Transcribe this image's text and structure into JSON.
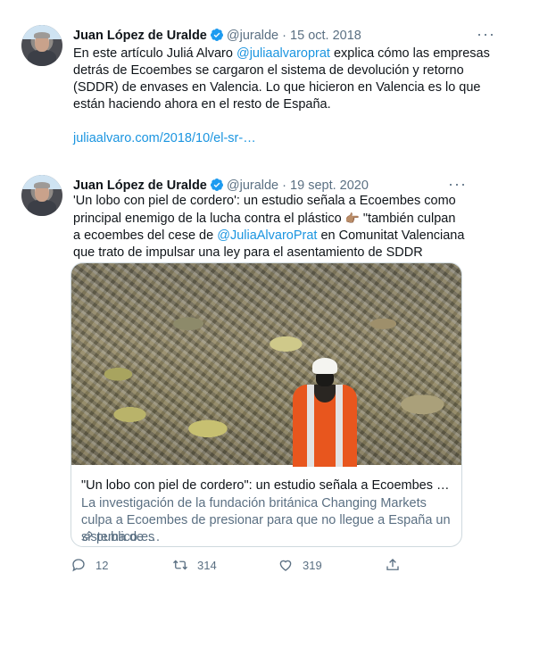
{
  "tweets": [
    {
      "author_name": "Juan López de Uralde",
      "handle": "@juralde",
      "separator": "·",
      "date": "15 oct. 2018",
      "text_1": "En este artículo Juliá Alvaro ",
      "mention_1": "@juliaalvaroprat",
      "text_2": " explica cómo las empresas detrás de Ecoembes se cargaron el sistema de devolución y retorno (SDDR) de envases en Valencia. Lo que hicieron en Valencia es lo que están haciendo ahora en el resto de España.",
      "link": "juliaalvaro.com/2018/10/el-sr-…",
      "more_label": "···"
    },
    {
      "author_name": "Juan López de Uralde",
      "handle": "@juralde",
      "separator": "·",
      "date": "19 sept. 2020",
      "text_1": "'Un lobo con piel de cordero': un estudio señala a Ecoembes como principal enemigo de la lucha contra el plástico ",
      "emoji": "👉🏽",
      "text_2": " \"también culpan a ecoembes del cese de ",
      "mention_1": "@JuliaAlvaroPrat",
      "text_3": " en Comunitat Valenciana que trato de impulsar una ley para el asentamiento de SDDR",
      "more_label": "···",
      "card": {
        "title": "\"Un lobo con piel de cordero\": un estudio señala a Ecoembes como pri…",
        "description": "La investigación de la fundación británica Changing Markets culpa a Ecoembes de presionar para que no llegue a España un sistema de …",
        "domain": "publico.es"
      },
      "actions": {
        "replies": "12",
        "retweets": "314",
        "likes": "319"
      }
    }
  ],
  "icons": {
    "verified": "verified-badge-icon",
    "more": "more-options-icon",
    "reply": "reply-icon",
    "retweet": "retweet-icon",
    "like": "heart-icon",
    "share": "share-icon",
    "link": "link-icon"
  },
  "colors": {
    "accent": "#1b95e0",
    "text": "#0f1419",
    "secondary": "#5b7083",
    "border": "#cfd9de"
  }
}
